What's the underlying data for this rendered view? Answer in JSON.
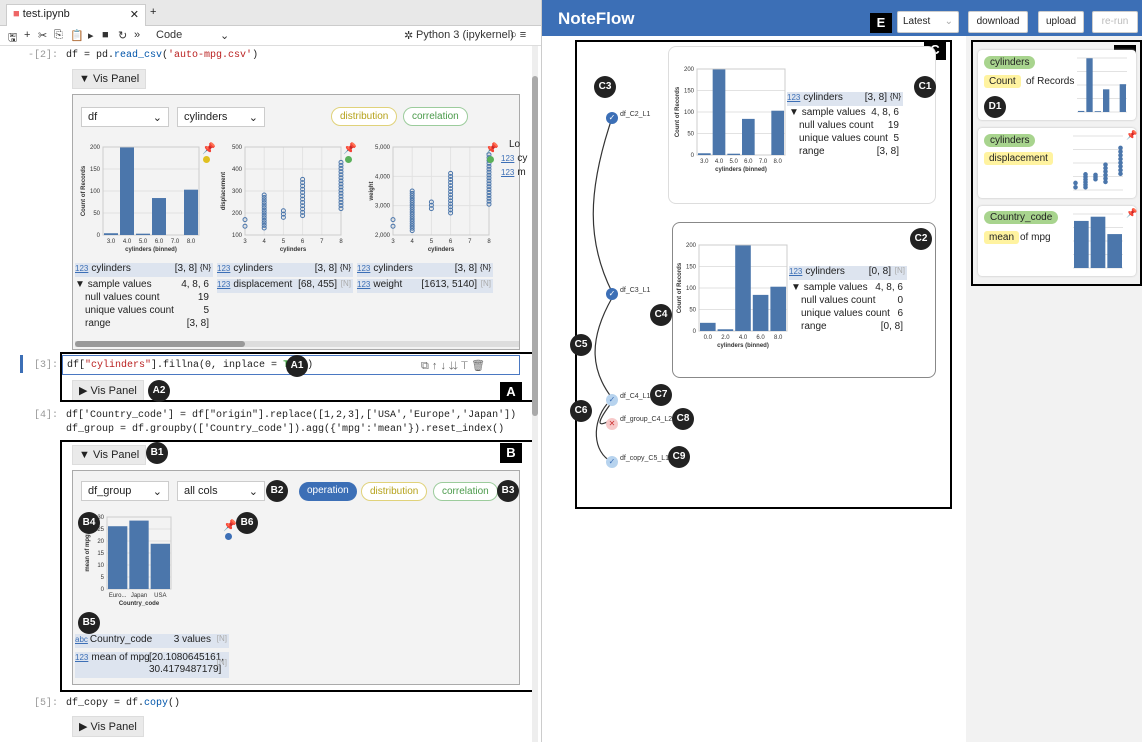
{
  "notebook": {
    "tab_title": "test.ipynb",
    "toolbar_mode": "Code",
    "kernel": "Python 3 (ipykernel)",
    "cells": {
      "c2": {
        "prompt": "-[2]:",
        "code": "df = pd.read_csv('auto-mpg.csv')"
      },
      "c3": {
        "prompt": "[3]:",
        "code": "df[\"cylinders\"].fillna(0, inplace = True)"
      },
      "c4": {
        "prompt": "[4]:",
        "code1": "df['Country_code'] = df[\"origin\"].replace([1,2,3],['USA','Europe','Japan'])",
        "code2": "df_group = df.groupby(['Country_code']).agg({'mpg':'mean'}).reset_index()"
      },
      "c5": {
        "prompt": "[5]:",
        "code": "df_copy = df.copy()"
      }
    },
    "vis_panel_label": "Vis Panel",
    "panel1": {
      "df_select": "df",
      "col_select": "cylinders",
      "pill_distribution": "distribution",
      "pill_correlation": "correlation",
      "chart1": {
        "ylabel": "Count of Records",
        "xlabel": "cylinders (binned)",
        "yticks": [
          "200",
          "150",
          "100",
          "50",
          "0"
        ],
        "xticks": [
          "3.0",
          "4.0",
          "5.0",
          "6.0",
          "7.0",
          "8.0"
        ]
      },
      "chart2": {
        "ylabel": "displacement",
        "xlabel": "cylinders",
        "yticks": [
          "500",
          "400",
          "300",
          "200",
          "100"
        ],
        "xticks": [
          "3",
          "4",
          "5",
          "6",
          "7",
          "8"
        ]
      },
      "chart3": {
        "ylabel": "weight",
        "xlabel": "cylinders",
        "yticks": [
          "5,000",
          "4,000",
          "3,000",
          "2,000"
        ],
        "xticks": [
          "3",
          "4",
          "5",
          "6",
          "7",
          "8"
        ]
      },
      "legend_title": "Lo",
      "legend_items": [
        "cy",
        "m"
      ],
      "meta1": {
        "name": "cylinders",
        "range": "[3, 8]",
        "tag": "{N}",
        "sample_label": "sample values",
        "sample": "4, 8, 6",
        "null_label": "null values count",
        "null": "19",
        "unique_label": "unique values count",
        "unique": "5",
        "range_label": "range",
        "range_val": "[3, 8]"
      },
      "meta2": {
        "name": "cylinders",
        "range": "[3, 8]",
        "tag": "{N}",
        "name2": "displacement",
        "range2": "[68, 455]",
        "tag2": "[N]"
      },
      "meta3": {
        "name": "cylinders",
        "range": "[3, 8]",
        "tag": "{N}",
        "name2": "weight",
        "range2": "[1613, 5140]",
        "tag2": "[N]"
      }
    },
    "panel2": {
      "df_select": "df_group",
      "col_select": "all cols",
      "pill_operation": "operation",
      "pill_distribution": "distribution",
      "pill_correlation": "correlation",
      "chart": {
        "ylabel": "mean of mpg",
        "xlabel": "Country_code",
        "yticks": [
          "30",
          "25",
          "20",
          "15",
          "10",
          "5",
          "0"
        ],
        "xticks": [
          "Euro...",
          "Japan",
          "USA"
        ]
      },
      "meta_a": {
        "type": "abc",
        "name": "Country_code",
        "value": "3 values",
        "tag": "[N]"
      },
      "meta_b": {
        "type": "123",
        "name": "mean of mpg",
        "value1": "[20.1080645161,",
        "value2": "30.4179487179]",
        "tag": "[N]"
      }
    },
    "badges": {
      "A": "A",
      "A1": "A1",
      "A2": "A2",
      "B": "B",
      "B1": "B1",
      "B2": "B2",
      "B3": "B3",
      "B4": "B4",
      "B5": "B5",
      "B6": "B6"
    }
  },
  "noteflow": {
    "title": "NoteFlow",
    "version_select": "Latest",
    "download": "download",
    "upload": "upload",
    "rerun": "re-run",
    "badges": {
      "C": "C",
      "D": "D",
      "E": "E",
      "C1": "C1",
      "C2": "C2",
      "C3": "C3",
      "C4": "C4",
      "C5": "C5",
      "C6": "C6",
      "C7": "C7",
      "C8": "C8",
      "C9": "C9",
      "D1": "D1"
    },
    "nodes": {
      "n1": "df_C2_L1",
      "n2": "df_C3_L1",
      "n3": "df_C4_L1",
      "n4": "df_group_C4_L2",
      "n5": "df_copy_C5_L1"
    },
    "card1": {
      "ylabel": "Count of Records",
      "xlabel": "cylinders (binned)",
      "yticks": [
        "200",
        "150",
        "100",
        "50",
        "0"
      ],
      "xticks": [
        "3.0",
        "4.0",
        "5.0",
        "6.0",
        "7.0",
        "8.0"
      ],
      "name": "cylinders",
      "range": "[3, 8]",
      "tag": "{N}",
      "sample_label": "sample values",
      "sample": "4, 8, 6",
      "null_label": "null values count",
      "null": "19",
      "unique_label": "unique values count",
      "unique": "5",
      "range_label": "range",
      "range_val": "[3, 8]"
    },
    "card2": {
      "ylabel": "Count of Records",
      "xlabel": "cylinders (binned)",
      "yticks": [
        "200",
        "150",
        "100",
        "50",
        "0"
      ],
      "xticks": [
        "0.0",
        "2.0",
        "4.0",
        "6.0",
        "8.0"
      ],
      "name": "cylinders",
      "range": "[0, 8]",
      "tag": "[N]",
      "sample_label": "sample values",
      "sample": "4, 8, 6",
      "null_label": "null values count",
      "null": "0",
      "unique_label": "unique values count",
      "unique": "6",
      "range_label": "range",
      "range_val": "[0, 8]"
    },
    "side_cards": [
      {
        "tag": "cylinders",
        "y": "Count",
        "text": "of Records"
      },
      {
        "tag": "cylinders",
        "y": "displacement",
        "text": ""
      },
      {
        "tag": "Country_code",
        "y": "mean",
        "text": "of mpg"
      }
    ]
  },
  "chart_data": [
    {
      "type": "bar",
      "title": "",
      "xlabel": "cylinders (binned)",
      "ylabel": "Count of Records",
      "categories": [
        "3.0",
        "4.0",
        "5.0",
        "6.0",
        "7.0",
        "8.0"
      ],
      "values": [
        4,
        199,
        3,
        84,
        0,
        103
      ],
      "ylim": [
        0,
        200
      ]
    },
    {
      "type": "bar",
      "title": "",
      "xlabel": "Country_code",
      "ylabel": "mean of mpg",
      "categories": [
        "Europe",
        "Japan",
        "USA"
      ],
      "values": [
        27.9,
        30.4,
        20.1
      ],
      "ylim": [
        0,
        32
      ]
    },
    {
      "type": "bar",
      "title": "",
      "xlabel": "cylinders (binned)",
      "ylabel": "Count of Records",
      "categories": [
        "0.0",
        "2.0",
        "4.0",
        "6.0",
        "8.0"
      ],
      "values": [
        19,
        4,
        199,
        84,
        103
      ],
      "ylim": [
        0,
        200
      ]
    }
  ]
}
